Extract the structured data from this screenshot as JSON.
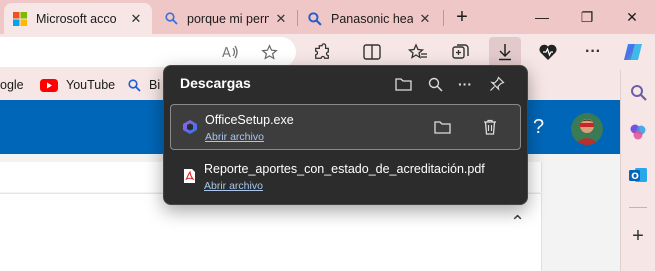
{
  "tabs": [
    {
      "label": "Microsoft acco",
      "icon": "microsoft-logo-icon",
      "active": true
    },
    {
      "label": "porque mi pern",
      "icon": "search-icon",
      "active": false
    },
    {
      "label": "Panasonic heac",
      "icon": "search-icon",
      "active": false
    }
  ],
  "tab_close_glyph": "✕",
  "new_tab_glyph": "+",
  "window_controls": {
    "minimize": "—",
    "maximize": "❐",
    "close": "✕"
  },
  "favorites": [
    {
      "label": "ogle",
      "icon": "google-icon"
    },
    {
      "label": "YouTube",
      "icon": "youtube-icon"
    },
    {
      "label": "Bi",
      "icon": "bing-search-icon"
    }
  ],
  "downloads": {
    "title": "Descargas",
    "items": [
      {
        "name": "OfficeSetup.exe",
        "link": "Abrir archivo",
        "icon": "office-setup-icon",
        "selected": true
      },
      {
        "name": "Reporte_aportes_con_estado_de_acreditación.pdf",
        "link": "Abrir archivo",
        "icon": "pdf-icon",
        "selected": false
      }
    ]
  },
  "page": {
    "help_glyph": "?",
    "collapse_glyph": "⌃"
  },
  "colors": {
    "tabstrip": "#f0c7c7",
    "toolbar": "#f7e6e6",
    "accent_blue": "#0067b8",
    "flyout_bg": "#2c2c2c",
    "link": "#a9c7ec"
  }
}
